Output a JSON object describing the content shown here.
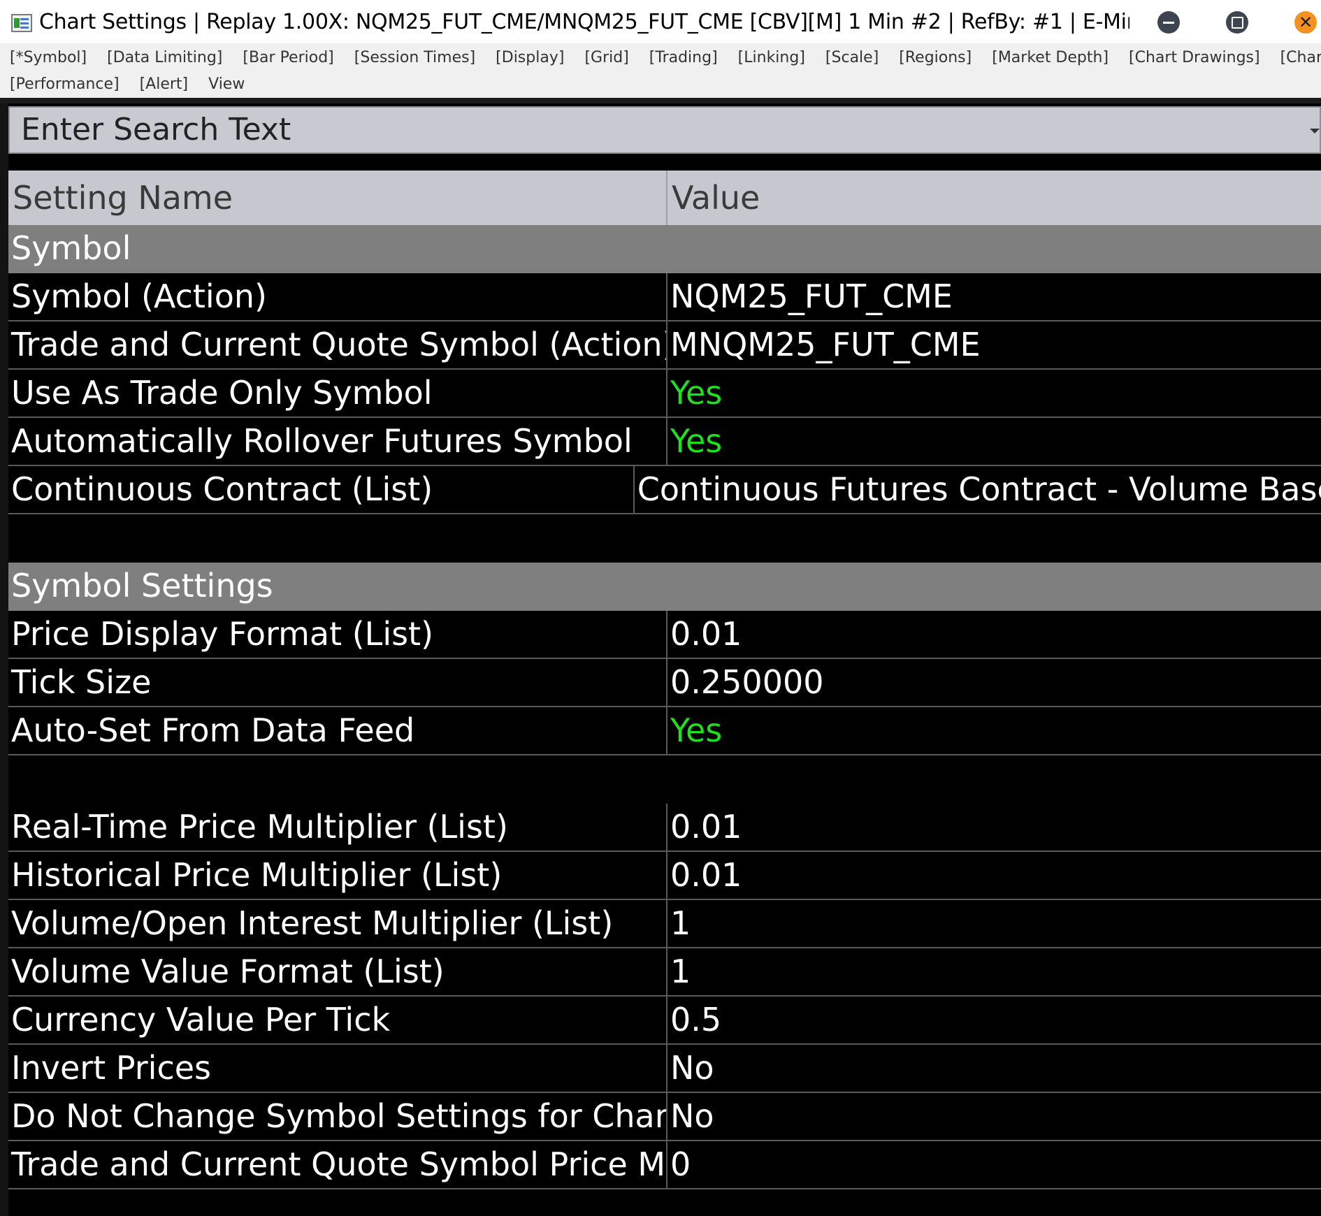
{
  "window": {
    "title": "Chart Settings | Replay 1.00X: NQM25_FUT_CME/MNQM25_FUT_CME [CBV][M]  1 Min  #2 | RefBy: #1 | E-Mini..."
  },
  "menu": {
    "row1": [
      "[*Symbol]",
      "[Data Limiting]",
      "[Bar Period]",
      "[Session Times]",
      "[Display]",
      "[Grid]",
      "[Trading]",
      "[Linking]",
      "[Scale]",
      "[Regions]",
      "[Market Depth]",
      "[Chart Drawings]",
      "[Chart Data]"
    ],
    "row2": [
      "[Performance]",
      "[Alert]",
      "View"
    ]
  },
  "search": {
    "placeholder": "Enter Search Text"
  },
  "table": {
    "headers": {
      "name": "Setting Name",
      "value": "Value"
    },
    "rows": [
      {
        "type": "group",
        "name": "Symbol"
      },
      {
        "type": "data",
        "name": "Symbol (Action)",
        "value": "NQM25_FUT_CME"
      },
      {
        "type": "data",
        "name": "Trade and Current Quote Symbol (Action)",
        "value": "MNQM25_FUT_CME"
      },
      {
        "type": "data",
        "name": "Use As Trade Only Symbol",
        "value": "Yes",
        "color": "#1fe01f"
      },
      {
        "type": "data",
        "name": "Automatically Rollover Futures Symbol",
        "value": "Yes",
        "color": "#1fe01f"
      },
      {
        "type": "data",
        "name": "Continuous Contract (List)",
        "value": "Continuous Futures Contract - Volume Based"
      },
      {
        "type": "blank"
      },
      {
        "type": "group",
        "name": "Symbol Settings"
      },
      {
        "type": "data",
        "name": "Price Display Format (List)",
        "value": "0.01"
      },
      {
        "type": "data",
        "name": "Tick Size",
        "value": "0.250000"
      },
      {
        "type": "data",
        "name": "Auto-Set From Data Feed",
        "value": "Yes",
        "color": "#1fe01f"
      },
      {
        "type": "blank"
      },
      {
        "type": "data",
        "name": "Real-Time Price Multiplier (List)",
        "value": "0.01"
      },
      {
        "type": "data",
        "name": "Historical Price Multiplier (List)",
        "value": "0.01"
      },
      {
        "type": "data",
        "name": "Volume/Open Interest Multiplier (List)",
        "value": "1"
      },
      {
        "type": "data",
        "name": "Volume Value Format (List)",
        "value": "1"
      },
      {
        "type": "data",
        "name": "Currency Value Per Tick",
        "value": "0.5"
      },
      {
        "type": "data",
        "name": "Invert Prices",
        "value": "No"
      },
      {
        "type": "data",
        "name": "Do Not Change Symbol Settings for Chart or Trading",
        "value": "No"
      },
      {
        "type": "data",
        "name": "Trade and Current Quote Symbol Price Multiplier",
        "value": "0"
      }
    ]
  }
}
